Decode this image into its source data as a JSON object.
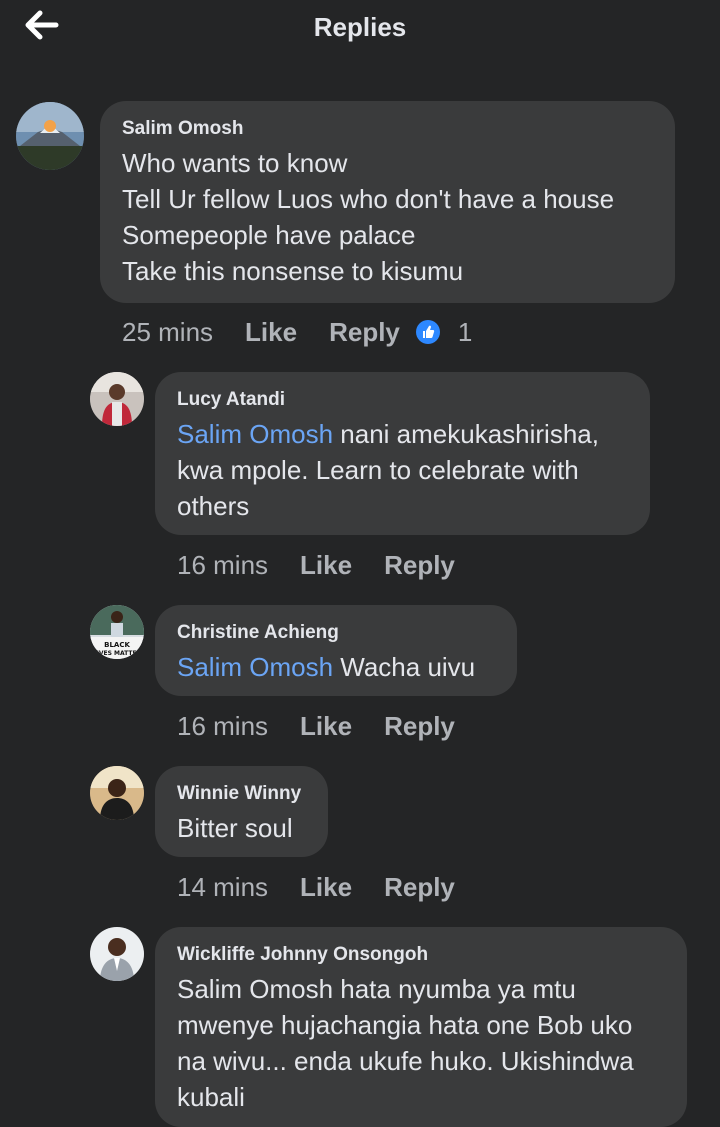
{
  "header": {
    "title": "Replies"
  },
  "comments": [
    {
      "name": "Salim Omosh",
      "mention": "",
      "lines": [
        "Who wants to know",
        "Tell Ur fellow Luos who don't have a house",
        "Somepeople  have palace",
        "Take this nonsense to kisumu"
      ],
      "time": "25 mins",
      "like": "Like",
      "reply": "Reply",
      "reaction_count": "1"
    },
    {
      "name": "Lucy Atandi",
      "mention": "Salim Omosh",
      "lines": [
        " nani amekukashirisha,",
        "kwa mpole. Learn to celebrate with",
        "others"
      ],
      "time": "16 mins",
      "like": "Like",
      "reply": "Reply"
    },
    {
      "name": "Christine Achieng",
      "mention": "Salim Omosh",
      "lines": [
        " Wacha uivu"
      ],
      "time": "16 mins",
      "like": "Like",
      "reply": "Reply",
      "avatar_text": "BLACK LIVES MATTER"
    },
    {
      "name": "Winnie Winny",
      "mention": "",
      "lines": [
        "Bitter soul"
      ],
      "time": "14 mins",
      "like": "Like",
      "reply": "Reply"
    },
    {
      "name": "Wickliffe Johnny Onsongoh",
      "mention": "",
      "lines": [
        "Salim Omosh hata nyumba ya mtu",
        "mwenye hujachangia hata one Bob uko",
        "na wivu... enda ukufe huko. Ukishindwa",
        "kubali"
      ],
      "time": "",
      "like": "",
      "reply": ""
    }
  ],
  "colors": {
    "background": "#242526",
    "bubble": "#3a3b3c",
    "mention": "#6ba5f5",
    "like_badge": "#2d88ff",
    "meta": "#b0b3b8"
  },
  "icons": {
    "back": "back-arrow-icon",
    "reaction": "thumbs-up-icon"
  }
}
